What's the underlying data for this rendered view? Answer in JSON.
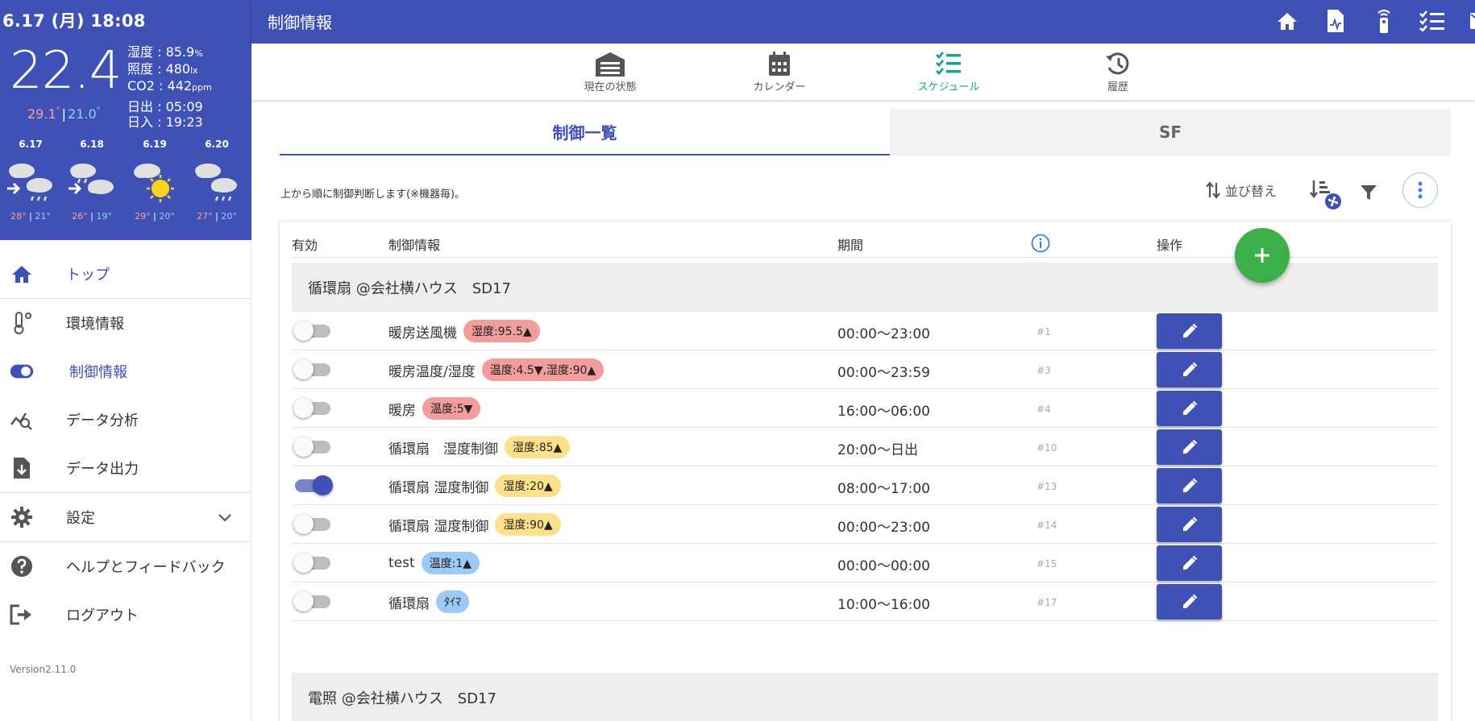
{
  "weather": {
    "date": "6.17 (月) 18:08",
    "temperature": "22.4",
    "high": "29.1",
    "low": "21.0",
    "deg": "°",
    "humidity_label": "湿度 : 85.9",
    "humidity_unit": "%",
    "illuminance_label": "照度 : 480",
    "illuminance_unit": "lx",
    "co2_label": "CO2 : 442",
    "co2_unit": "ppm",
    "sunrise": "日出 : 05:09",
    "sunset": "日入 : 19:23",
    "forecast": [
      {
        "date": "6.17",
        "high": "28",
        "low": "21",
        "icon": "cloud-then-rain-icon"
      },
      {
        "date": "6.18",
        "high": "26",
        "low": "19",
        "icon": "rain-then-cloud-icon"
      },
      {
        "date": "6.19",
        "high": "29",
        "low": "20",
        "icon": "cloud-sun-icon"
      },
      {
        "date": "6.20",
        "high": "27",
        "low": "20",
        "icon": "cloud-rain-icon"
      }
    ]
  },
  "nav": {
    "top": "トップ",
    "environment": "環境情報",
    "control": "制御情報",
    "analysis": "データ分析",
    "export": "データ出力",
    "settings": "設定",
    "help": "ヘルプとフィードバック",
    "logout": "ログアウト"
  },
  "version": "Version2.11.0",
  "topbar": {
    "title": "制御情報",
    "icons": [
      "home-icon",
      "document-chart-icon",
      "remote-icon",
      "checklist-icon",
      "mail-icon"
    ]
  },
  "subnav": {
    "status": "現在の状態",
    "calendar": "カレンダー",
    "schedule": "スケジュール",
    "history": "履歴"
  },
  "tabs": {
    "list": "制御一覧",
    "sf": "SF"
  },
  "toolbar": {
    "hint": "上から順に制御判断します(※機器毎)。",
    "sort": "並び替え"
  },
  "table": {
    "headers": {
      "enabled": "有効",
      "info": "制御情報",
      "period": "期間",
      "actions": "操作"
    },
    "groups": [
      {
        "name": "循環扇 @会社横ハウス　SD17",
        "rows": [
          {
            "name": "暖房送風機",
            "badge": "湿度:95.5▲",
            "color": "#f29c9c",
            "period": "00:00〜23:00",
            "num": "#1",
            "enabled": false
          },
          {
            "name": "暖房温度/湿度",
            "badge": "温度:4.5▼,湿度:90▲",
            "color": "#f29c9c",
            "period": "00:00〜23:59",
            "num": "#3",
            "enabled": false
          },
          {
            "name": "暖房",
            "badge": "温度:5▼",
            "color": "#f29c9c",
            "period": "16:00〜06:00",
            "num": "#4",
            "enabled": false
          },
          {
            "name": "循環扇　湿度制御",
            "badge": "湿度:85▲",
            "color": "#fde18a",
            "period": "20:00〜日出",
            "num": "#10",
            "enabled": false
          },
          {
            "name": "循環扇 湿度制御",
            "badge": "湿度:20▲",
            "color": "#fde18a",
            "period": "08:00〜17:00",
            "num": "#13",
            "enabled": true
          },
          {
            "name": "循環扇 湿度制御",
            "badge": "湿度:90▲",
            "color": "#fde18a",
            "period": "00:00〜23:00",
            "num": "#14",
            "enabled": false
          },
          {
            "name": "test",
            "badge": "温度:1▲",
            "color": "#9dcaf5",
            "period": "00:00〜00:00",
            "num": "#15",
            "enabled": false
          },
          {
            "name": "循環扇",
            "badge": "ﾀｲﾏ",
            "color": "#9dcaf5",
            "period": "10:00〜16:00",
            "num": "#17",
            "enabled": false
          }
        ]
      },
      {
        "name": "電照 @会社横ハウス　SD17",
        "rows": []
      }
    ]
  }
}
